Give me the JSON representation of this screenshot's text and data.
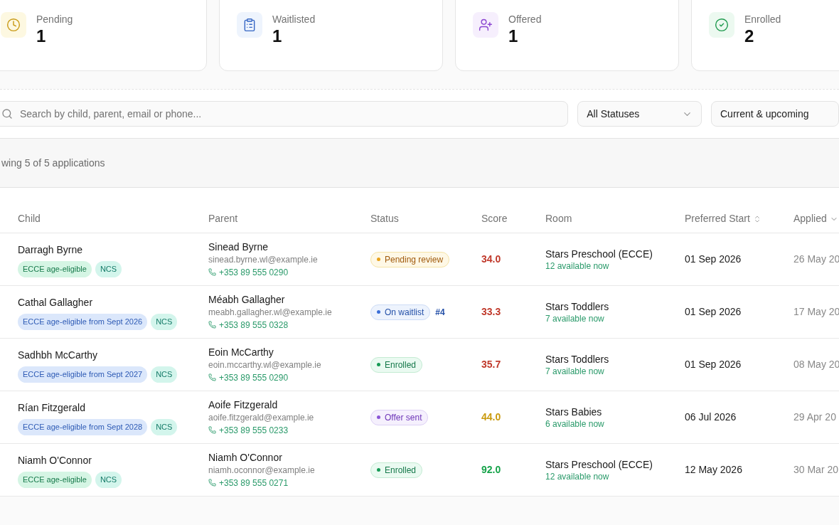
{
  "stats": [
    {
      "kind": "pending",
      "label": "Pending",
      "value": "1"
    },
    {
      "kind": "waitlisted",
      "label": "Waitlisted",
      "value": "1"
    },
    {
      "kind": "offered",
      "label": "Offered",
      "value": "1"
    },
    {
      "kind": "enrolled",
      "label": "Enrolled",
      "value": "2"
    }
  ],
  "filters": {
    "search": {
      "placeholder": "Search by child, parent, email or phone..."
    },
    "status_select": "All Statuses",
    "period_select": "Current & upcoming"
  },
  "summary": "wing 5 of 5 applications",
  "table": {
    "columns": [
      {
        "label": "Child",
        "kind": "plain"
      },
      {
        "label": "Parent",
        "kind": "plain"
      },
      {
        "label": "Status",
        "kind": "plain"
      },
      {
        "label": "Score",
        "kind": "plain"
      },
      {
        "label": "Room",
        "kind": "plain"
      },
      {
        "label": "Preferred Start",
        "kind": "sortable"
      },
      {
        "label": "Applied",
        "kind": "sorted"
      }
    ],
    "rows": [
      {
        "child": "Darragh Byrne",
        "tags": [
          {
            "kind": "eligible",
            "text": "ECCE age-eligible"
          },
          {
            "kind": "ncs",
            "text": "NCS"
          }
        ],
        "parent": "Sinead Byrne",
        "email": "sinead.byrne.wl@example.ie",
        "phone": "+353 89 555 0290",
        "status": {
          "kind": "pending",
          "text": "Pending review"
        },
        "score": {
          "text": "34.0",
          "color": "#c0392b"
        },
        "room": "Stars Preschool (ECCE)",
        "availability": "12 available now",
        "start": "01 Sep 2026",
        "applied": "26 May 20"
      },
      {
        "child": "Cathal Gallagher",
        "tags": [
          {
            "kind": "future",
            "text": "ECCE age-eligible from Sept 2026"
          },
          {
            "kind": "ncs",
            "text": "NCS"
          }
        ],
        "parent": "Méabh Gallagher",
        "email": "meabh.gallagher.wl@example.ie",
        "phone": "+353 89 555 0328",
        "status": {
          "kind": "waitlist",
          "text": "On waitlist",
          "position": "#4"
        },
        "score": {
          "text": "33.3",
          "color": "#c0392b"
        },
        "room": "Stars Toddlers",
        "availability": "7 available now",
        "start": "01 Sep 2026",
        "applied": "17 May 20"
      },
      {
        "child": "Sadhbh McCarthy",
        "tags": [
          {
            "kind": "future",
            "text": "ECCE age-eligible from Sept 2027"
          },
          {
            "kind": "ncs",
            "text": "NCS"
          }
        ],
        "parent": "Eoin McCarthy",
        "email": "eoin.mccarthy.wl@example.ie",
        "phone": "+353 89 555 0290",
        "status": {
          "kind": "enrolled",
          "text": "Enrolled"
        },
        "score": {
          "text": "35.7",
          "color": "#c0392b"
        },
        "room": "Stars Toddlers",
        "availability": "7 available now",
        "start": "01 Sep 2026",
        "applied": "08 May 20"
      },
      {
        "child": "Rían Fitzgerald",
        "tags": [
          {
            "kind": "future",
            "text": "ECCE age-eligible from Sept 2028"
          },
          {
            "kind": "ncs",
            "text": "NCS"
          }
        ],
        "parent": "Aoife Fitzgerald",
        "email": "aoife.fitzgerald@example.ie",
        "phone": "+353 89 555 0233",
        "status": {
          "kind": "offer",
          "text": "Offer sent"
        },
        "score": {
          "text": "44.0",
          "color": "#ca9a0e"
        },
        "room": "Stars Babies",
        "availability": "6 available now",
        "start": "06 Jul 2026",
        "applied": "29 Apr 20"
      },
      {
        "child": "Niamh O'Connor",
        "tags": [
          {
            "kind": "eligible",
            "text": "ECCE age-eligible"
          },
          {
            "kind": "ncs",
            "text": "NCS"
          }
        ],
        "parent": "Niamh O'Connor",
        "email": "niamh.oconnor@example.ie",
        "phone": "+353 89 555 0271",
        "status": {
          "kind": "enrolled",
          "text": "Enrolled"
        },
        "score": {
          "text": "92.0",
          "color": "#16a34a"
        },
        "room": "Stars Preschool (ECCE)",
        "availability": "12 available now",
        "start": "12 May 2026",
        "applied": "30 Mar 20"
      }
    ]
  }
}
